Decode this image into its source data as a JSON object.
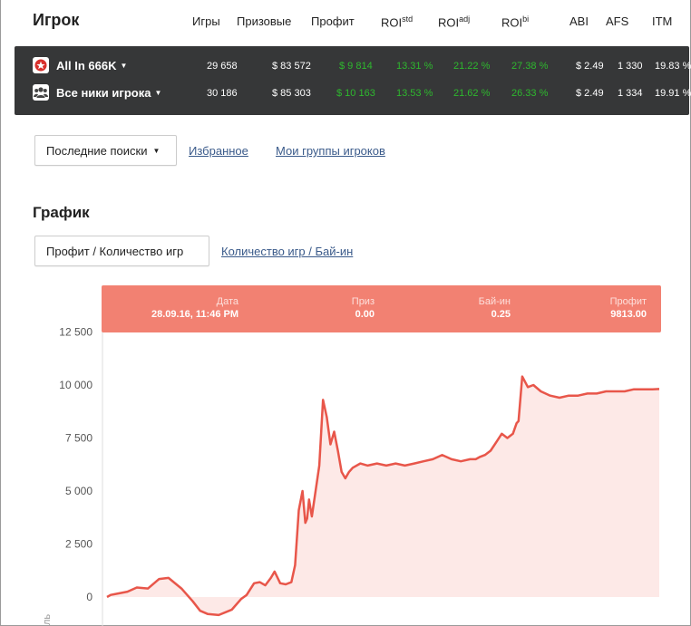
{
  "header": {
    "title": "Игрок",
    "columns": [
      {
        "label": "Игры",
        "sup": ""
      },
      {
        "label": "Призовые",
        "sup": ""
      },
      {
        "label": "Профит",
        "sup": ""
      },
      {
        "label": "ROI",
        "sup": "std"
      },
      {
        "label": "ROI",
        "sup": "adj"
      },
      {
        "label": "ROI",
        "sup": "bi"
      },
      {
        "label": "ABI",
        "sup": ""
      },
      {
        "label": "AFS",
        "sup": ""
      },
      {
        "label": "ITM",
        "sup": ""
      }
    ]
  },
  "stats": {
    "rows": [
      {
        "name": "All In 666K",
        "icon": "pokerstars-icon",
        "games": "29 658",
        "prize": "$ 83 572",
        "profit": "$ 9 814",
        "roi_std": "13.31 %",
        "roi_adj": "21.22 %",
        "roi_bi": "27.38 %",
        "abi": "$ 2.49",
        "afs": "1 330",
        "itm": "19.83 %"
      },
      {
        "name": "Все ники игрока",
        "icon": "group-icon",
        "games": "30 186",
        "prize": "$ 85 303",
        "profit": "$ 10 163",
        "roi_std": "13.53 %",
        "roi_adj": "21.62 %",
        "roi_bi": "26.33 %",
        "abi": "$ 2.49",
        "afs": "1 334",
        "itm": "19.91 %"
      }
    ]
  },
  "nav": {
    "recent_label": "Последние поиски",
    "favorites_label": "Избранное",
    "groups_label": "Мои группы игроков"
  },
  "chart_section": {
    "title": "График",
    "tab_active": "Профит / Количество игр",
    "tab_inactive": "Количество игр / Бай-ин"
  },
  "tooltip": {
    "date_label": "Дата",
    "date_value": "28.09.16, 11:46 PM",
    "prize_label": "Приз",
    "prize_value": "0.00",
    "buyin_label": "Бай-ин",
    "buyin_value": "0.25",
    "profit_label": "Профит",
    "profit_value": "9813.00"
  },
  "colors": {
    "line": "#e8564a",
    "fill": "#fde9e7",
    "tooltip": "#f28172",
    "green": "#2eb82e",
    "dark": "#363738"
  },
  "chart_data": {
    "type": "area",
    "ylabel": "",
    "ylim": [
      -1000,
      12500
    ],
    "yticks": [
      "12 500",
      "10 000",
      "7 500",
      "5 000",
      "2 500",
      "0"
    ],
    "ytick_values": [
      12500,
      10000,
      7500,
      5000,
      2500,
      0
    ],
    "axis_fragment": "ль",
    "x": [
      0,
      200,
      500,
      1100,
      1600,
      2200,
      2800,
      3300,
      4000,
      4600,
      5000,
      5400,
      6000,
      6700,
      7200,
      7500,
      7900,
      8200,
      8500,
      8800,
      9000,
      9300,
      9600,
      9900,
      10100,
      10300,
      10500,
      10650,
      10750,
      10850,
      11000,
      11200,
      11400,
      11600,
      11800,
      12000,
      12200,
      12400,
      12600,
      12800,
      13000,
      13200,
      13600,
      14000,
      14500,
      15000,
      15500,
      16000,
      16500,
      17000,
      17500,
      18000,
      18500,
      19000,
      19500,
      19800,
      20000,
      20300,
      20600,
      20900,
      21200,
      21500,
      21800,
      22000,
      22100,
      22300,
      22600,
      22900,
      23300,
      23800,
      24300,
      24800,
      25300,
      25800,
      26300,
      26800,
      27300,
      27800,
      28300,
      28800,
      29300,
      29658
    ],
    "values": [
      0,
      100,
      150,
      250,
      450,
      400,
      850,
      900,
      400,
      -200,
      -650,
      -800,
      -850,
      -600,
      -100,
      100,
      650,
      700,
      550,
      900,
      1200,
      650,
      600,
      700,
      1500,
      4100,
      5000,
      3500,
      3700,
      4600,
      3800,
      5000,
      6200,
      9300,
      8500,
      7200,
      7800,
      6900,
      5900,
      5600,
      5900,
      6100,
      6300,
      6200,
      6300,
      6200,
      6300,
      6200,
      6300,
      6400,
      6500,
      6700,
      6500,
      6400,
      6500,
      6500,
      6600,
      6700,
      6900,
      7300,
      7700,
      7500,
      7700,
      8200,
      8300,
      10400,
      9900,
      10000,
      9700,
      9500,
      9400,
      9500,
      9500,
      9600,
      9600,
      9700,
      9700,
      9700,
      9800,
      9800,
      9800,
      9813
    ]
  }
}
